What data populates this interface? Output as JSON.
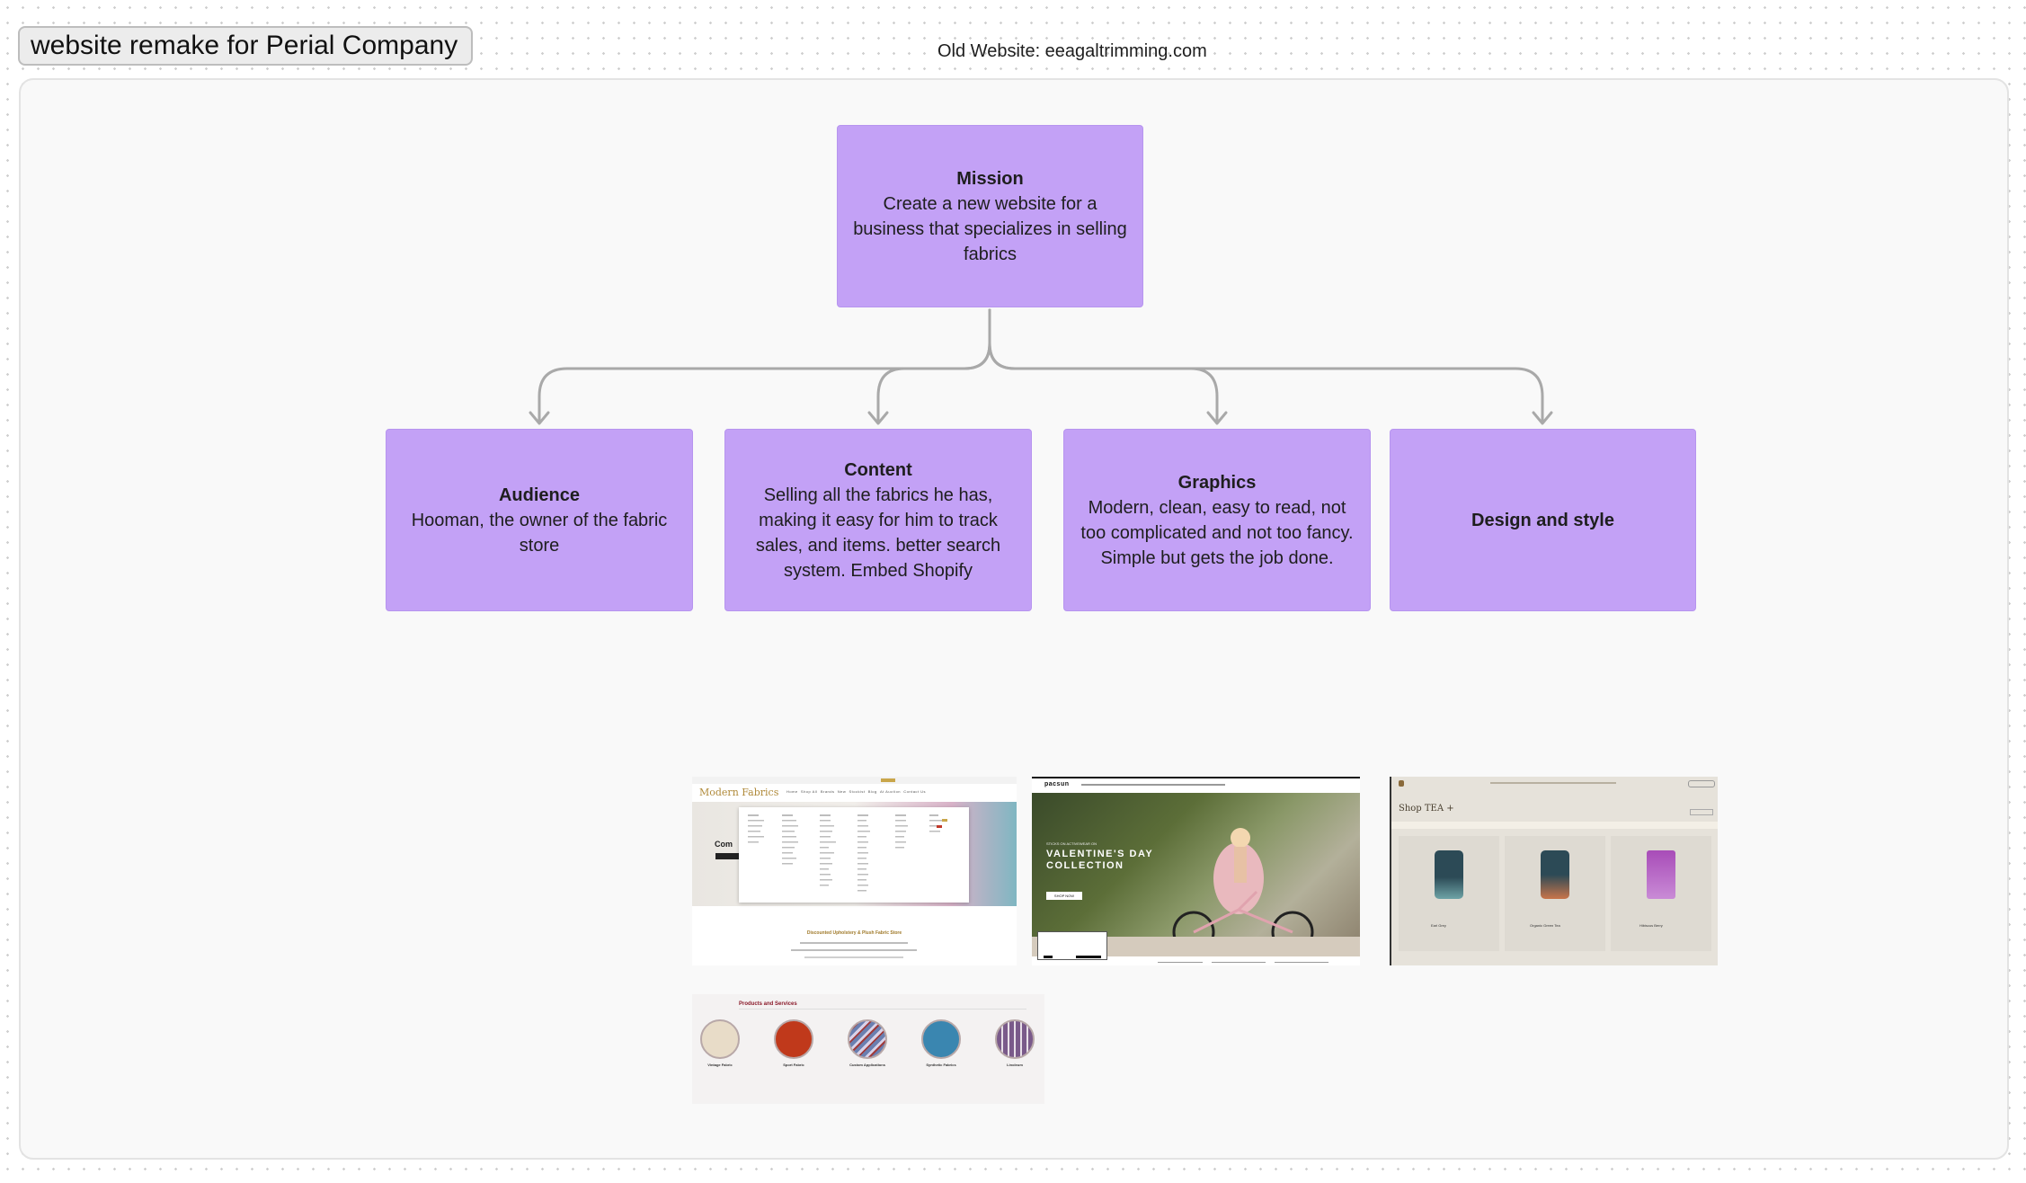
{
  "board_title": "website remake for Perial Company",
  "old_website_note": "Old Website: eeagaltrimming.com",
  "nodes": {
    "mission": {
      "title": "Mission",
      "text": "Create a new website for a business that specializes in selling fabrics"
    },
    "audience": {
      "title": "Audience",
      "text": "Hooman, the owner of the fabric store"
    },
    "content": {
      "title": "Content",
      "text": "Selling all the fabrics he has, making it easy for him to track sales, and items. better search system. Embed Shopify"
    },
    "graphics": {
      "title": "Graphics",
      "text": "Modern, clean, easy to read, not too complicated and not too fancy. Simple but gets the job done."
    },
    "design": {
      "title": "Design and style",
      "text": ""
    }
  },
  "thumbnails": {
    "modern_fabrics": {
      "logo": "Modern Fabrics",
      "nav": [
        "Home",
        "Shop All",
        "Brands",
        "New",
        "Stockist",
        "Blog",
        "At Auction",
        "Contact Us"
      ],
      "store_heading": "Discounted Upholstery & Plush Fabric Store"
    },
    "valentines": {
      "brand": "pacsun",
      "kicker": "STICKS ON ACTIVEWEAR ON",
      "headline": "VALENTINE'S DAY COLLECTION",
      "cta": "SHOP NOW"
    },
    "tea": {
      "heading": "Shop TEA +",
      "products": [
        {
          "name": "Earl Grey"
        },
        {
          "name": "Organic Green Tea"
        },
        {
          "name": "Hibiscus Berry"
        }
      ]
    },
    "products_services": {
      "heading": "Products and Services",
      "items": [
        {
          "label": "Vintage Fabric",
          "color": "#e8dcc8"
        },
        {
          "label": "Sport Fabric",
          "color": "#c0391b"
        },
        {
          "label": "Custom Applications",
          "color": "#6a7fb0"
        },
        {
          "label": "Synthetic Fabrics",
          "color": "#3a86b0"
        },
        {
          "label": "Linoleum",
          "color": "#7a5a8a"
        }
      ]
    }
  }
}
